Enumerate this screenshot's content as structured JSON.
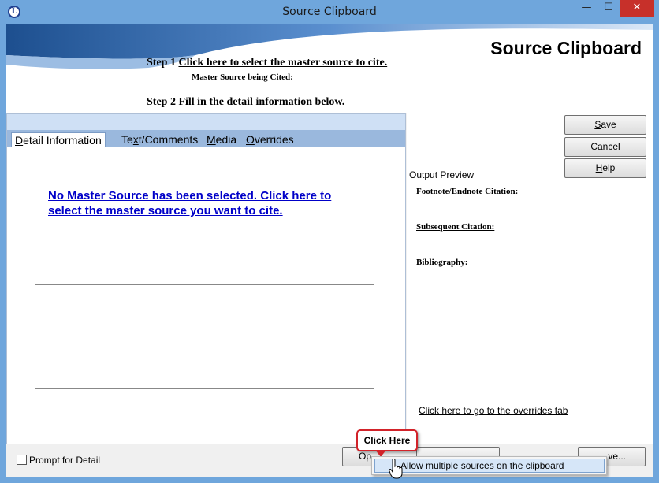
{
  "window": {
    "title": "Source Clipboard",
    "app_icon_letter": "L",
    "min_glyph": "—",
    "max_glyph": "☐",
    "close_glyph": "✕"
  },
  "header": {
    "banner_title": "Source Clipboard",
    "step1_prefix": "Step 1 ",
    "step1_link": "Click here to select the master source to cite.",
    "master_source_label": "Master Source being Cited:",
    "step2": "Step 2 Fill in the detail information below."
  },
  "tabs": [
    {
      "prefix": "",
      "mnemonic": "D",
      "suffix": "etail Information"
    },
    {
      "prefix": "Te",
      "mnemonic": "x",
      "suffix": "t/Comments"
    },
    {
      "prefix": "",
      "mnemonic": "M",
      "suffix": "edia"
    },
    {
      "prefix": "",
      "mnemonic": "O",
      "suffix": "verrides"
    }
  ],
  "detail": {
    "no_master_line1": "No Master Source has been selected.  Click here to",
    "no_master_line2": "select the master source you want to cite."
  },
  "buttons": {
    "save_mnemonic": "S",
    "save_rest": "ave",
    "cancel": "Cancel",
    "help_mnemonic": "H",
    "help_rest": "elp",
    "options_partial": "Op",
    "save_as_partial": "ve..."
  },
  "preview": {
    "heading": "Output Preview",
    "footnote": "Footnote/Endnote Citation:",
    "subsequent": "Subsequent Citation:",
    "bibliography": "Bibliography:",
    "overrides_link": "Click here to go to the overrides tab"
  },
  "bottom": {
    "prompt_label": "Prompt for Detail",
    "prompt_checked": false
  },
  "callout": {
    "text": "Click Here"
  },
  "context_menu": {
    "item": "Allow multiple sources on the clipboard"
  },
  "colors": {
    "title_bar": "#6fa6dc",
    "close_button": "#c7302a",
    "link_blue": "#0000c8",
    "callout_border": "#d2232a",
    "tab_strip": "#9ab8dd"
  }
}
